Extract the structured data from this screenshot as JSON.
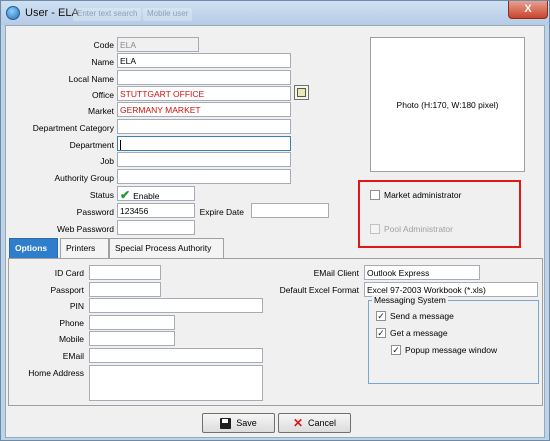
{
  "window": {
    "title": "User - ELA",
    "ghost_tabs": [
      "Enter text search",
      "Mobile user"
    ],
    "close_label": "X"
  },
  "form": {
    "code": {
      "label": "Code",
      "value": "ELA"
    },
    "name": {
      "label": "Name",
      "value": "ELA"
    },
    "local_name": {
      "label": "Local Name",
      "value": ""
    },
    "office": {
      "label": "Office",
      "value": "STUTTGART OFFICE"
    },
    "market": {
      "label": "Market",
      "value": "GERMANY MARKET"
    },
    "department_category": {
      "label": "Department Category",
      "value": ""
    },
    "department": {
      "label": "Department",
      "value": ""
    },
    "job": {
      "label": "Job",
      "value": ""
    },
    "authority_group": {
      "label": "Authority Group",
      "value": ""
    },
    "status": {
      "label": "Status",
      "value": "Enable"
    },
    "password": {
      "label": "Password",
      "value": "123456"
    },
    "expire_date": {
      "label": "Expire Date",
      "value": ""
    },
    "web_password": {
      "label": "Web Password",
      "value": ""
    }
  },
  "photo": {
    "text": "Photo (H:170, W:180 pixel)"
  },
  "checkboxes": {
    "market_admin": {
      "label": "Market administrator",
      "checked": false
    },
    "pool_admin": {
      "label": "Pool Administrator",
      "checked": false,
      "disabled": true
    }
  },
  "tabs": [
    "Options",
    "Printers",
    "Special Process Authority"
  ],
  "options": {
    "id_card": {
      "label": "ID Card",
      "value": ""
    },
    "passport": {
      "label": "Passport",
      "value": ""
    },
    "pin": {
      "label": "PIN",
      "value": ""
    },
    "phone": {
      "label": "Phone",
      "value": ""
    },
    "mobile": {
      "label": "Mobile",
      "value": ""
    },
    "email": {
      "label": "EMail",
      "value": ""
    },
    "home_address": {
      "label": "Home Address",
      "value": ""
    },
    "email_client": {
      "label": "EMail Client",
      "value": "Outlook Express"
    },
    "default_excel_format": {
      "label": "Default Excel Format",
      "value": "Excel 97-2003 Workbook (*.xls)"
    }
  },
  "messaging": {
    "title": "Messaging System",
    "send": {
      "label": "Send a message",
      "checked": true
    },
    "get": {
      "label": "Get a message",
      "checked": true
    },
    "popup": {
      "label": "Popup message window",
      "checked": true
    }
  },
  "buttons": {
    "save": "Save",
    "cancel": "Cancel"
  },
  "colors": {
    "accent_tab": "#2f7ecc",
    "highlight_box": "#e01818",
    "red_text": "#d01010"
  }
}
